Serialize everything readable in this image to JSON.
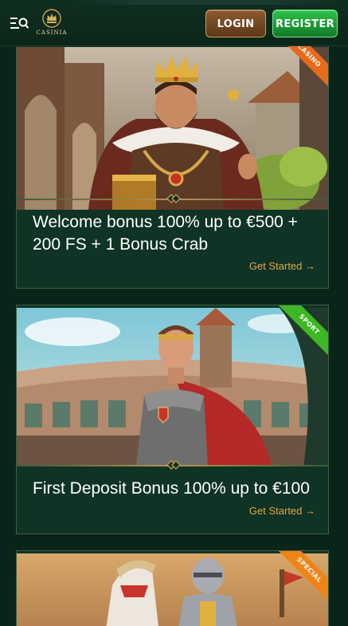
{
  "header": {
    "logo_text": "CASINIA",
    "login_label": "LOGIN",
    "register_label": "REGISTER"
  },
  "promos": [
    {
      "ribbon": "CASINO",
      "title": "Welcome bonus 100% up to €500 + 200 FS + 1 Bonus Crab",
      "cta": "Get Started →"
    },
    {
      "ribbon": "SPORT",
      "title": "First Deposit Bonus 100% up to €100",
      "cta": "Get Started →"
    },
    {
      "ribbon": "SPECIAL"
    }
  ],
  "colors": {
    "background": "#0b2419",
    "card": "#0f3324",
    "accent_gold": "#e2a64a",
    "register_green": "#1fa33a",
    "login_brown": "#7a4a22"
  }
}
